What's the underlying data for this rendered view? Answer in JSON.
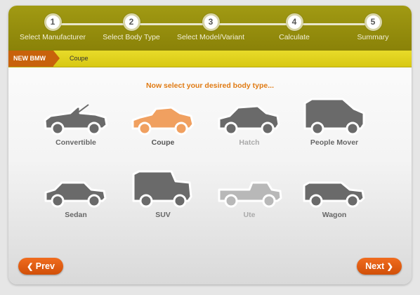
{
  "steps": [
    {
      "number": "1",
      "label": "Select Manufacturer"
    },
    {
      "number": "2",
      "label": "Select Body Type"
    },
    {
      "number": "3",
      "label": "Select Model/Variant"
    },
    {
      "number": "4",
      "label": "Calculate"
    },
    {
      "number": "5",
      "label": "Summary"
    }
  ],
  "breadcrumb": {
    "manufacturer": "NEW BMW",
    "selected_body": "Coupe"
  },
  "prompt": "Now select your desired body type...",
  "body_types": [
    {
      "label": "Convertible",
      "icon": "convertible-car-icon",
      "state": "available"
    },
    {
      "label": "Coupe",
      "icon": "coupe-car-icon",
      "state": "selected"
    },
    {
      "label": "Hatch",
      "icon": "hatch-car-icon",
      "state": "disabled"
    },
    {
      "label": "People Mover",
      "icon": "people-mover-car-icon",
      "state": "available"
    },
    {
      "label": "Sedan",
      "icon": "sedan-car-icon",
      "state": "available"
    },
    {
      "label": "SUV",
      "icon": "suv-car-icon",
      "state": "available"
    },
    {
      "label": "Ute",
      "icon": "ute-car-icon",
      "state": "disabled"
    },
    {
      "label": "Wagon",
      "icon": "wagon-car-icon",
      "state": "available"
    }
  ],
  "nav": {
    "prev_label": "Prev",
    "next_label": "Next",
    "prev_icon": "chevron-left-icon",
    "next_icon": "chevron-right-icon"
  },
  "colors": {
    "stepbar": "#8a8208",
    "crumbbar": "#d8c812",
    "brand_tag": "#c8620b",
    "accent": "#e07a12",
    "selected_car": "#f0a060",
    "available_car": "#6a6a6a",
    "disabled_car": "#b8b8b8",
    "button": "#e05a10"
  }
}
